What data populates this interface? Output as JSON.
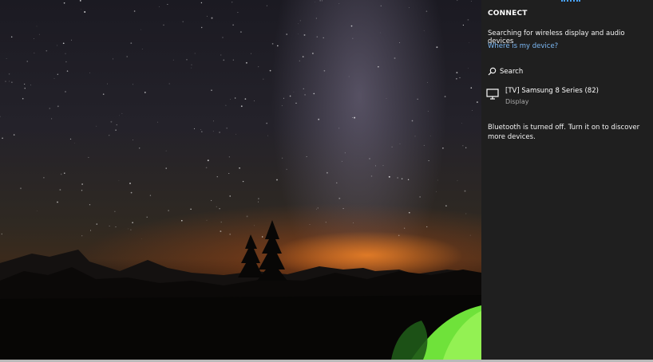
{
  "connect_panel": {
    "title": "CONNECT",
    "status_text": "Searching for wireless display and audio devices",
    "help_link": "Where is my device?",
    "search_label": "Search",
    "devices": [
      {
        "name": "[TV] Samsung 8 Series (82)",
        "type": "Display",
        "icon": "monitor-icon"
      }
    ],
    "bluetooth_message": "Bluetooth is turned off. Turn it on to discover more devices.",
    "accent_color": "#7cb9f5"
  },
  "desktop": {
    "wallpaper": "night sky with milky way, mountain silhouettes, pine trees, glowing green tent"
  }
}
